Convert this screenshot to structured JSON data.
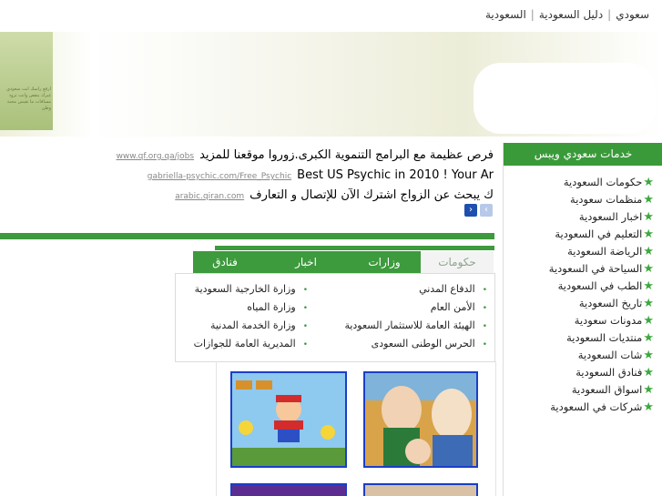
{
  "top_nav": {
    "links": [
      "سعودي",
      "دليل السعودية",
      "السعودية"
    ],
    "separator": "|"
  },
  "banner": {
    "left_text": "ارفع راسك انت سعودي غيرك ينقص وانت تزود مسافات ما تقيس محبة وطن"
  },
  "ads": [
    {
      "title": "فرص عظيمة مع البرامج التنموية الكبرى.زوروا موقعنا للمزيد",
      "url": "www.qf.org.qa/jobs"
    },
    {
      "title": "Best US Psychic in 2010 ! Your Ar",
      "url": "gabriella-psychic.com/Free_Psychic"
    },
    {
      "title": "ك يبحث عن الزواج اشترك الآن للإتصال و التعارف",
      "url": "arabic.qiran.com"
    }
  ],
  "ad_nav": {
    "prev": "‹",
    "next": "›"
  },
  "tabs": [
    {
      "label": "حكومات",
      "active": true
    },
    {
      "label": "وزارات",
      "active": false
    },
    {
      "label": "اخبار",
      "active": false
    },
    {
      "label": "فنادق",
      "active": false
    }
  ],
  "tab_panel": {
    "right_column": [
      "الدفاع المدني",
      "الأمن العام",
      "الهيئة العامة للاستثمار السعودية",
      "الحرس الوطنى السعودى"
    ],
    "left_column": [
      "وزارة الخارجية السعودية",
      "وزارة المياه",
      "وزارة الخدمة المدنية",
      "المديرية العامة للجوازات"
    ],
    "bullet": "•"
  },
  "sidebar": {
    "title": "خدمات سعودي ويبس",
    "star_icon": "★",
    "items": [
      "حكومات السعودية",
      "منظمات سعودية",
      "اخبار السعودية",
      "التعليم في السعودية",
      "الرياضة السعودية",
      "السياحة في السعودية",
      "الطب في السعودية",
      "تاريخ السعودية",
      "مدونات سعودية",
      "منتديات السعودية",
      "شات السعودية",
      "فنادق السعودية",
      "اسواق السعودية",
      "شركات في السعودية"
    ]
  },
  "games": [
    {
      "name": "family-guy-thumbnail",
      "icon": "cartoon-family-image"
    },
    {
      "name": "mario-thumbnail",
      "icon": "mario-game-image"
    },
    {
      "name": "thumbnail-3",
      "icon": "game-image"
    },
    {
      "name": "thumbnail-4",
      "icon": "game-image"
    }
  ],
  "colors": {
    "brand_green": "#3d9a3d",
    "thumb_border": "#1a3ec9",
    "active_tab_text": "#8fa58f"
  }
}
